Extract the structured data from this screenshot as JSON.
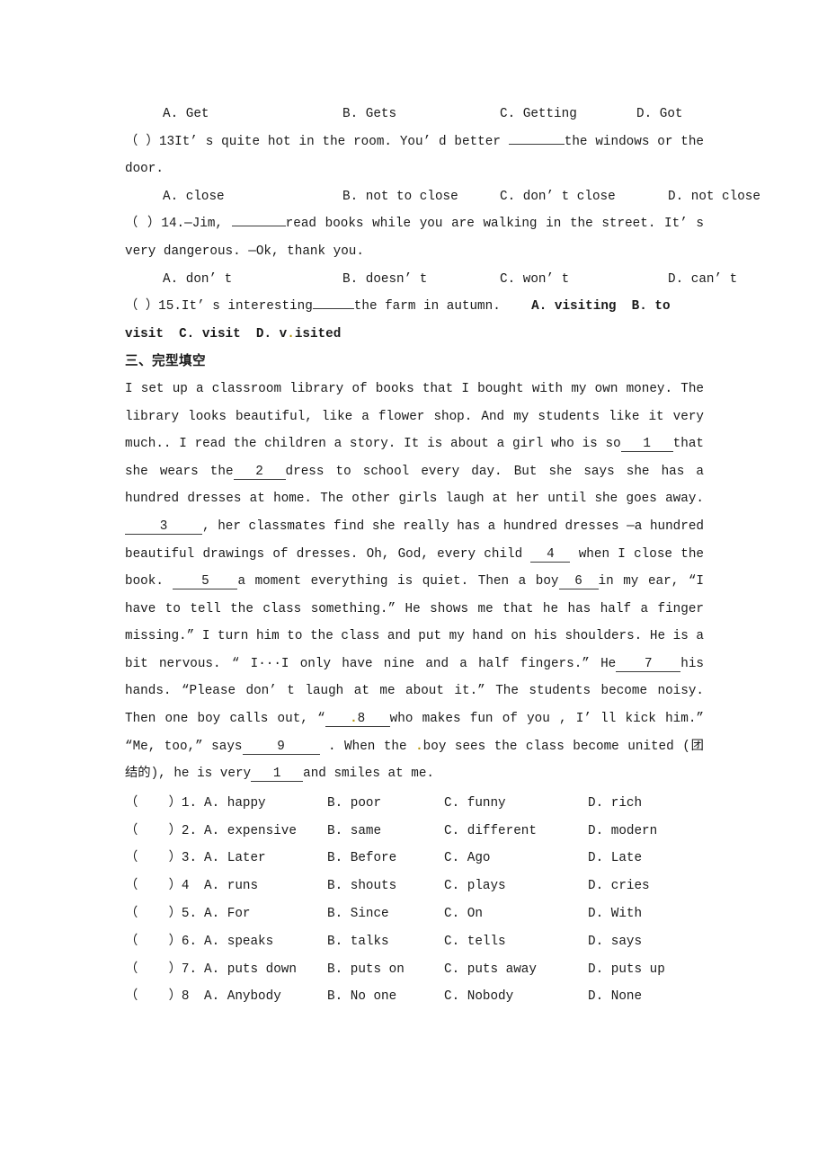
{
  "document": {
    "language": "en-zh",
    "section_heading": "三、完型填空"
  },
  "questions": [
    {
      "id": "q12-options",
      "options_inline": {
        "a": "A. Get",
        "b": "B. Gets",
        "c": "C. Getting",
        "d": "D. Got"
      }
    },
    {
      "id": "q13",
      "marker": "（    ）13",
      "stem_part1": "It’ s quite hot in the room. You’ d better ",
      "stem_part2": "the windows or the door.",
      "options_inline": {
        "a": "A. close",
        "b": "B. not to close",
        "c": "C. don’ t close",
        "d": "D. not close"
      }
    },
    {
      "id": "q14",
      "marker": "（    ）14.",
      "stem_part1": "—Jim, ",
      "stem_part2": "read books while you are walking in the street. It’ s very dangerous. —Ok, thank you.",
      "options_inline": {
        "a": "A. don’ t",
        "b": "B. doesn’ t",
        "c": "C. won’ t",
        "d": "D. can’ t"
      }
    },
    {
      "id": "q15",
      "marker": "（    ）15.",
      "stem_part1": "It’ s interesting",
      "stem_part2": "the farm in autumn.",
      "options_bold": {
        "a": "A. visiting",
        "b": "B. to visit",
        "c": "C. visit",
        "d": "D. v",
        "d_tail": "isited"
      }
    }
  ],
  "cloze_passage": {
    "line1": " I set up a classroom library of books that I bought with my own money. The library looks beautiful, like a flower shop. And my students like it very much..",
    "seg1": "I read the children a story. It is about a girl who is so",
    "blank1": "1",
    "seg2": "that she wears the",
    "blank2": "2",
    "seg3": "dress to school every day. But she says she has a hundred dresses at home. The other girls laugh at her until she goes away.",
    "blank3": "3",
    "seg4": ", her classmates find she really has a hundred dresses —a hundred beautiful drawings of dresses. Oh, God, every child",
    "blank4": "4",
    "seg5": "when I close the book.",
    "blank5": "5",
    "seg6": "a moment everything is quiet. Then a boy",
    "blank6": "6",
    "seg7": "in my ear, “I have to tell the class something.” He shows me that he has half a finger missing.” I turn him to the class and put my hand on his shoulders. He is a bit nervous. “ I···I only have nine and a half fingers.” He",
    "blank7": "7",
    "seg8": "his hands. “Please don’ t laugh at me about it.”  The students become noisy. Then one boy calls out, “",
    "blank8": "8",
    "seg9": "who makes fun of you , I’ ll kick him.”  “Me, too,” says",
    "blank9": "9",
    "seg10": ". When the",
    "seg10b": "boy sees the class become united (团结的), he is very",
    "blank10": "1",
    "seg11": "and smiles at me."
  },
  "cloze_answers": {
    "rows": [
      {
        "num": "（    ）1.",
        "a": "A. happy",
        "b": "B. poor",
        "c": "C. funny",
        "d": "D. rich"
      },
      {
        "num": "（    ）2.",
        "a": "A. expensive",
        "b": "B. same",
        "c": "C. different",
        "d": "D. modern"
      },
      {
        "num": "（    ）3.",
        "a": "A. Later",
        "b": "B. Before",
        "c": "C. Ago",
        "d": "D. Late"
      },
      {
        "num": "（    ）4",
        "a": "A. runs",
        "b": "B. shouts",
        "c": "C. plays",
        "d": "D. cries"
      },
      {
        "num": "（    ）5.",
        "a": "A. For",
        "b": "B. Since",
        "c": "C. On",
        "d": "D. With"
      },
      {
        "num": "（    ）6.",
        "a": "A. speaks",
        "b": "B. talks",
        "c": "C. tells",
        "d": "D. says"
      },
      {
        "num": "（    ）7.",
        "a": "A. puts down",
        "b": "B. puts on",
        "c": "C. puts away",
        "d": "D. puts up"
      },
      {
        "num": "（    ）8",
        "a": "A. Anybody",
        "b": "B. No one",
        "c": "C. Nobody",
        "d": "D. None"
      }
    ]
  },
  "colors": {
    "text": "#1a1a1a",
    "rule": "#3a3a3a",
    "speck": "#b8960b",
    "background": "#ffffff"
  }
}
